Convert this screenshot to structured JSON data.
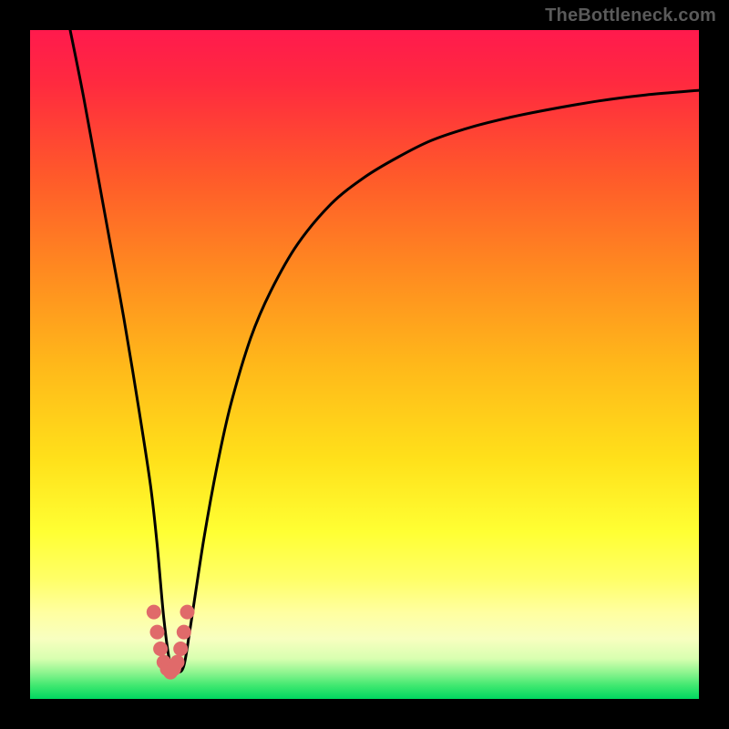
{
  "watermark": "TheBottleneck.com",
  "colors": {
    "frame_bg_top": "#ff1a4d",
    "frame_bg_bottom": "#00d860",
    "curve_stroke": "#000000",
    "marker_fill": "#e06a6a",
    "page_bg": "#000000"
  },
  "chart_data": {
    "type": "line",
    "title": "",
    "xlabel": "",
    "ylabel": "",
    "xlim": [
      0,
      100
    ],
    "ylim": [
      0,
      100
    ],
    "grid": false,
    "legend": false,
    "series": [
      {
        "name": "bottleneck-curve",
        "x": [
          6,
          8,
          10,
          12,
          14,
          16,
          18,
          19,
          20,
          21,
          22,
          23,
          24,
          26,
          28,
          30,
          33,
          36,
          40,
          45,
          50,
          55,
          60,
          66,
          72,
          78,
          85,
          92,
          100
        ],
        "values": [
          100,
          90,
          79,
          68,
          57,
          45,
          32,
          23,
          12,
          5,
          4,
          5,
          11,
          24,
          35,
          44,
          54,
          61,
          68,
          74,
          78,
          81,
          83.5,
          85.5,
          87,
          88.2,
          89.4,
          90.3,
          91
        ]
      }
    ],
    "markers": {
      "name": "highlight-dots",
      "x": [
        18.5,
        19.0,
        19.5,
        20.0,
        20.5,
        21.0,
        21.5,
        22.0,
        22.5,
        23.0,
        23.5
      ],
      "values": [
        13.0,
        10.0,
        7.5,
        5.5,
        4.5,
        4.0,
        4.5,
        5.5,
        7.5,
        10.0,
        13.0
      ]
    }
  }
}
